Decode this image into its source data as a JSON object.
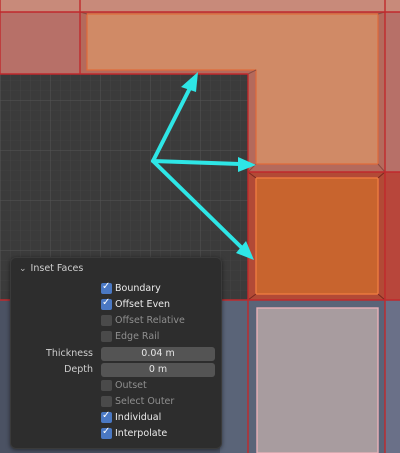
{
  "operator_panel": {
    "title": "Inset Faces",
    "checkboxes_top": [
      {
        "label": "Boundary",
        "checked": true
      },
      {
        "label": "Offset Even",
        "checked": true
      },
      {
        "label": "Offset Relative",
        "checked": false
      },
      {
        "label": "Edge Rail",
        "checked": false
      }
    ],
    "fields": [
      {
        "label": "Thickness",
        "value": "0.04 m"
      },
      {
        "label": "Depth",
        "value": "0 m"
      }
    ],
    "checkboxes_bottom": [
      {
        "label": "Outset",
        "checked": false
      },
      {
        "label": "Select Outer",
        "checked": false
      },
      {
        "label": "Individual",
        "checked": true
      },
      {
        "label": "Interpolate",
        "checked": true
      }
    ]
  },
  "colors": {
    "grid_bg": "#3b3b3b",
    "face_salmon": "#c1756b",
    "face_selected": "#c8642e",
    "face_inner_pale": "#a89c9f",
    "face_blue": "#5a6478",
    "edge_red": "#c0292c",
    "arrow_cyan": "#2ee6e6"
  }
}
